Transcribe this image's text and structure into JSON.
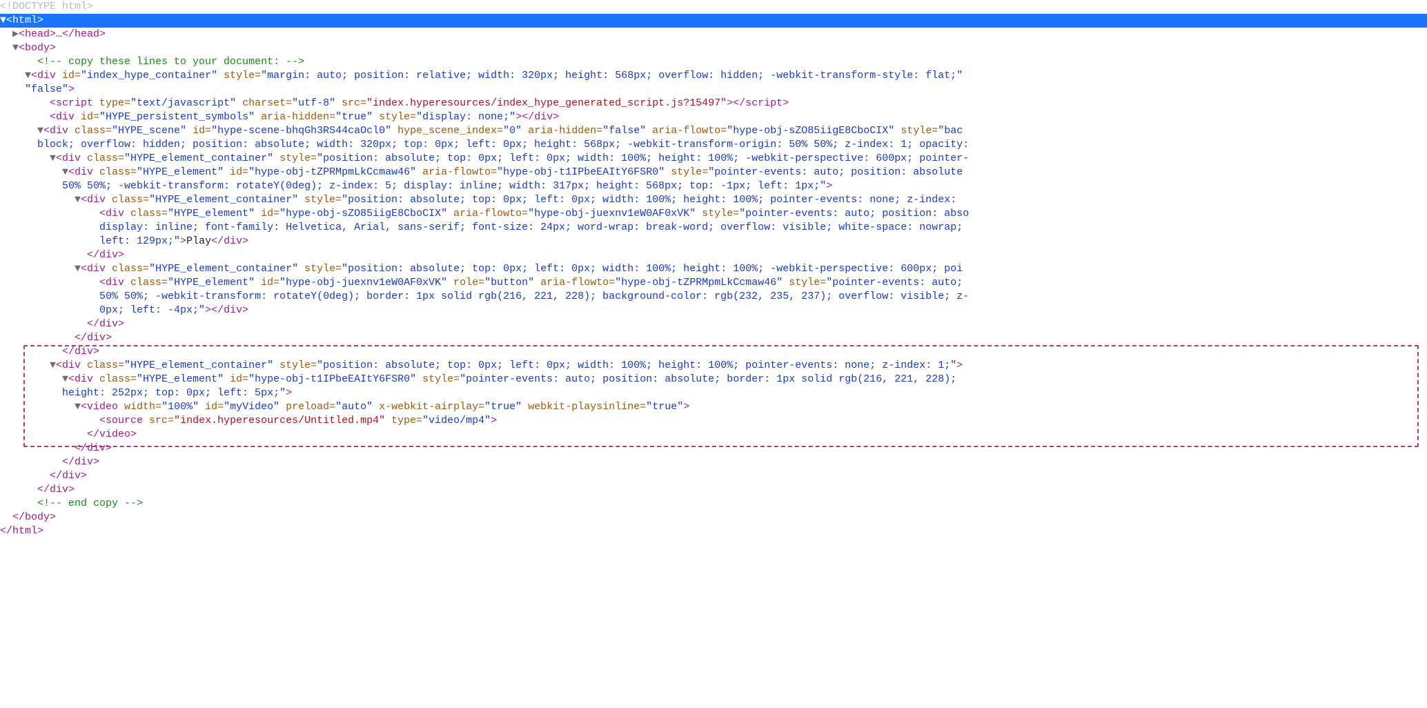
{
  "lines": {
    "l00_doctype": "<!DOCTYPE html>",
    "l01_html_open": "<html>",
    "l02a": "<head>",
    "l02b": "…",
    "l02c": "</head>",
    "l03_body_open": "<body>",
    "l04_comment": "<!-- copy these lines to your document: -->",
    "l05a": "<div ",
    "l05_attr1n": "id=",
    "l05_attr1v": "\"index_hype_container\"",
    "l05_attr2n": " style=",
    "l05_attr2v": "\"margin: auto; position: relative; width: 320px; height: 568px; overflow: hidden; -webkit-transform-style: flat;\"",
    "l05b_tail": ">",
    "l06_false": "\"false\"",
    "l06_gt": ">",
    "l07a": "<script ",
    "l07_t": "type=",
    "l07_tv": "\"text/javascript\"",
    "l07_c": " charset=",
    "l07_cv": "\"utf-8\"",
    "l07_s": " src=",
    "l07_sv": "\"index.hyperesources/index_hype_generated_script.js?15497\"",
    "l07b": ">",
    "l07c": "</script>",
    "l08a": "<div ",
    "l08_id": "id=",
    "l08_idv": "\"HYPE_persistent_symbols\"",
    "l08_ah": " aria-hidden=",
    "l08_ahv": "\"true\"",
    "l08_st": " style=",
    "l08_stv": "\"display: none;\"",
    "l08b": ">",
    "l08c": "</div>",
    "l09a": "<div ",
    "l09_cl": "class=",
    "l09_clv": "\"HYPE_scene\"",
    "l09_id": " id=",
    "l09_idv": "\"hype-scene-bhqGh3RS44caOcl0\"",
    "l09_hs": " hype_scene_index=",
    "l09_hsv": "\"0\"",
    "l09_ah": " aria-hidden=",
    "l09_ahv": "\"false\"",
    "l09_af": " aria-flowto=",
    "l09_afv": "\"hype-obj-sZO85iigE8CboCIX\"",
    "l09_st": " style=",
    "l09_stv": "\"bac",
    "l10_cont": "block; overflow: hidden; position: absolute; width: 320px; top: 0px; left: 0px; height: 568px; -webkit-transform-origin: 50% 50%; z-index: 1; opacity:",
    "l11a": "<div ",
    "l11_cl": "class=",
    "l11_clv": "\"HYPE_element_container\"",
    "l11_st": " style=",
    "l11_stv": "\"position: absolute; top: 0px; left: 0px; width: 100%; height: 100%; -webkit-perspective: 600px; pointer-",
    "l12a": "<div ",
    "l12_cl": "class=",
    "l12_clv": "\"HYPE_element\"",
    "l12_id": " id=",
    "l12_idv": "\"hype-obj-tZPRMpmLkCcmaw46\"",
    "l12_af": " aria-flowto=",
    "l12_afv": "\"hype-obj-t1IPbeEAItY6FSR0\"",
    "l12_st": " style=",
    "l12_stv": "\"pointer-events: auto; position: absolute",
    "l13_cont": "50% 50%; -webkit-transform: rotateY(0deg); z-index: 5; display: inline; width: 317px; height: 568px; top: -1px; left: 1px;\"",
    "l13_gt": ">",
    "l14a": "<div ",
    "l14_cl": "class=",
    "l14_clv": "\"HYPE_element_container\"",
    "l14_st": " style=",
    "l14_stv": "\"position: absolute; top: 0px; left: 0px; width: 100%; height: 100%; pointer-events: none; z-index:",
    "l15a": "<div ",
    "l15_cl": "class=",
    "l15_clv": "\"HYPE_element\"",
    "l15_id": " id=",
    "l15_idv": "\"hype-obj-sZO85iigE8CboCIX\"",
    "l15_af": " aria-flowto=",
    "l15_afv": "\"hype-obj-juexnv1eW0AF0xVK\"",
    "l15_st": " style=",
    "l15_stv": "\"pointer-events: auto; position: abso",
    "l16_cont": "display: inline; font-family: Helvetica, Arial, sans-serif; font-size: 24px; word-wrap: break-word; overflow: visible; white-space: nowrap;",
    "l17_cont": "left: 129px;\"",
    "l17_gt": ">",
    "l17_play": "Play",
    "l17_close": "</div>",
    "l18_close": "</div>",
    "l19a": "<div ",
    "l19_cl": "class=",
    "l19_clv": "\"HYPE_element_container\"",
    "l19_st": " style=",
    "l19_stv": "\"position: absolute; top: 0px; left: 0px; width: 100%; height: 100%; -webkit-perspective: 600px; poi",
    "l20a": "<div ",
    "l20_cl": "class=",
    "l20_clv": "\"HYPE_element\"",
    "l20_id": " id=",
    "l20_idv": "\"hype-obj-juexnv1eW0AF0xVK\"",
    "l20_ro": " role=",
    "l20_rov": "\"button\"",
    "l20_af": " aria-flowto=",
    "l20_afv": "\"hype-obj-tZPRMpmLkCcmaw46\"",
    "l20_st": " style=",
    "l20_stv": "\"pointer-events: auto;",
    "l21_cont": "50% 50%; -webkit-transform: rotateY(0deg); border: 1px solid rgb(216, 221, 228); background-color: rgb(232, 235, 237); overflow: visible; z-",
    "l22_cont": "0px; left: -4px;\"",
    "l22_gt": ">",
    "l22_close": "</div>",
    "l23_close": "</div>",
    "l24_close": "</div>",
    "l25_close": "</div>",
    "l26a": "<div ",
    "l26_cl": "class=",
    "l26_clv": "\"HYPE_element_container\"",
    "l26_st": " style=",
    "l26_stv": "\"position: absolute; top: 0px; left: 0px; width: 100%; height: 100%; pointer-events: none; z-index: 1;\"",
    "l26_gt": ">",
    "l27a": "<div ",
    "l27_cl": "class=",
    "l27_clv": "\"HYPE_element\"",
    "l27_id": " id=",
    "l27_idv": "\"hype-obj-t1IPbeEAItY6FSR0\"",
    "l27_st": " style=",
    "l27_stv": "\"pointer-events: auto; position: absolute; border: 1px solid rgb(216, 221, 228);",
    "l28_cont": "height: 252px; top: 0px; left: 5px;\"",
    "l28_gt": ">",
    "l29a": "<video ",
    "l29_w": "width=",
    "l29_wv": "\"100%\"",
    "l29_id": " id=",
    "l29_idv": "\"myVideo\"",
    "l29_pr": " preload=",
    "l29_prv": "\"auto\"",
    "l29_xa": " x-webkit-airplay=",
    "l29_xav": "\"true\"",
    "l29_pi": " webkit-playsinline=",
    "l29_piv": "\"true\"",
    "l29b": ">",
    "l30a": "<source ",
    "l30_s": "src=",
    "l30_sv": "\"index.hyperesources/Untitled.mp4\"",
    "l30_t": " type=",
    "l30_tv": "\"video/mp4\"",
    "l30b": ">",
    "l31_close": "</video>",
    "l32_close": "</div>",
    "l33_close": "</div>",
    "l34_close": "</div>",
    "l35_close": "</div>",
    "l36_comment": "<!-- end copy -->",
    "l37_close": "</body>",
    "l38_close": "</html>"
  }
}
